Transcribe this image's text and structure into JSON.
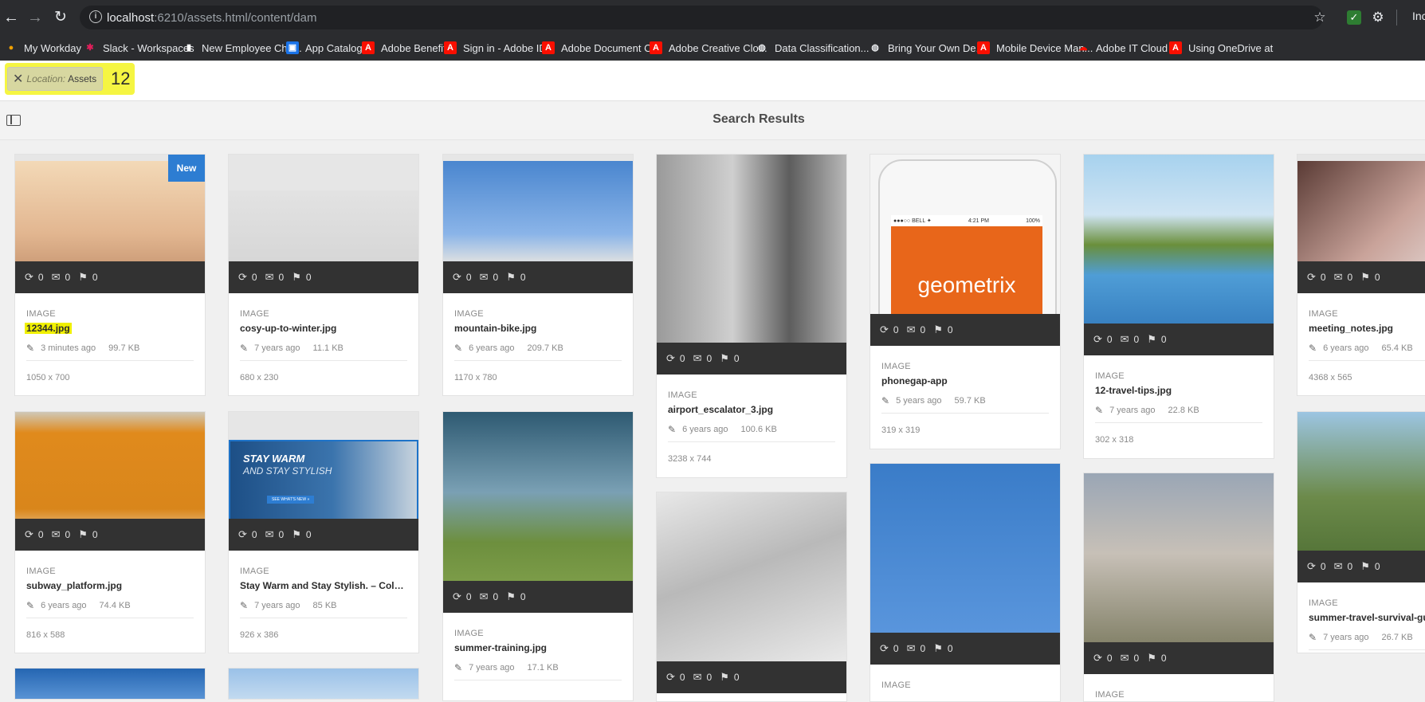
{
  "browser": {
    "url_host": "localhost",
    "url_rest": ":6210/assets.html/content/dam",
    "right_partial": "Inc",
    "bookmarks": [
      {
        "label": "My Workday",
        "icon": "workday-icon",
        "color": "#f0a000"
      },
      {
        "label": "Slack - Workspaces",
        "icon": "slack-icon",
        "color": "#e01e5a"
      },
      {
        "label": "New Employee Che...",
        "icon": "page-icon",
        "color": "#ffffff"
      },
      {
        "label": "App Catalog",
        "icon": "app-catalog-icon",
        "color": "#1a73e8"
      },
      {
        "label": "Adobe Benefits",
        "icon": "adobe-icon",
        "color": "#fa0f00"
      },
      {
        "label": "Sign in - Adobe ID",
        "icon": "adobe-icon",
        "color": "#fa0f00"
      },
      {
        "label": "Adobe Document C...",
        "icon": "acrobat-icon",
        "color": "#fa0f00"
      },
      {
        "label": "Adobe Creative Clo...",
        "icon": "adobe-icon",
        "color": "#fa0f00"
      },
      {
        "label": "Data Classification...",
        "icon": "globe-icon",
        "color": "#e8eaed"
      },
      {
        "label": "Bring Your Own De...",
        "icon": "globe-icon",
        "color": "#e8eaed"
      },
      {
        "label": "Mobile Device Man...",
        "icon": "adobe-icon",
        "color": "#fa0f00"
      },
      {
        "label": "Adobe IT Cloud",
        "icon": "cloud-icon",
        "color": "#fa0f00"
      },
      {
        "label": "Using OneDrive at",
        "icon": "adobe-icon",
        "color": "#fa0f00"
      }
    ]
  },
  "omnibar": {
    "tag_label": "Location:",
    "tag_value": "Assets",
    "count": "12"
  },
  "actionbar": {
    "title": "Search Results"
  },
  "cards": [
    {
      "type": "IMAGE",
      "name": "12344.jpg",
      "age": "3 minutes ago",
      "size": "99.7 KB",
      "dims": "1050 x 700",
      "refs": "0",
      "comments": "0",
      "tasks": "0",
      "badge": "New"
    },
    {
      "type": "IMAGE",
      "name": "cosy-up-to-winter.jpg",
      "age": "7 years ago",
      "size": "11.1 KB",
      "dims": "680 x 230",
      "refs": "0",
      "comments": "0",
      "tasks": "0"
    },
    {
      "type": "IMAGE",
      "name": "mountain-bike.jpg",
      "age": "6 years ago",
      "size": "209.7 KB",
      "dims": "1170 x 780",
      "refs": "0",
      "comments": "0",
      "tasks": "0"
    },
    {
      "type": "IMAGE",
      "name": "airport_escalator_3.jpg",
      "age": "6 years ago",
      "size": "100.6 KB",
      "dims": "3238 x 744",
      "refs": "0",
      "comments": "0",
      "tasks": "0"
    },
    {
      "type": "IMAGE",
      "name": "phonegap-app",
      "age": "5 years ago",
      "size": "59.7 KB",
      "dims": "319 x 319",
      "refs": "0",
      "comments": "0",
      "tasks": "0",
      "phone_text": "geometrix",
      "phone_status_left": "●●●○○ BELL ✦",
      "phone_status_time": "4:21 PM",
      "phone_status_right": "100%"
    },
    {
      "type": "IMAGE",
      "name": "12-travel-tips.jpg",
      "age": "7 years ago",
      "size": "22.8 KB",
      "dims": "302 x 318",
      "refs": "0",
      "comments": "0",
      "tasks": "0"
    },
    {
      "type": "IMAGE",
      "name": "meeting_notes.jpg",
      "age": "6 years ago",
      "size": "65.4 KB",
      "dims": "4368 x 565",
      "refs": "0",
      "comments": "0",
      "tasks": "0"
    },
    {
      "type": "IMAGE",
      "name": "subway_platform.jpg",
      "age": "6 years ago",
      "size": "74.4 KB",
      "dims": "816 x 588",
      "refs": "0",
      "comments": "0",
      "tasks": "0"
    },
    {
      "type": "IMAGE",
      "name": "Stay Warm and Stay Stylish. – Cold ...",
      "age": "7 years ago",
      "size": "85 KB",
      "dims": "926 x 386",
      "refs": "0",
      "comments": "0",
      "tasks": "0",
      "banner_title": "STAY WARM",
      "banner_sub": "AND STAY STYLISH",
      "banner_btn": "SEE WHAT'S NEW »"
    },
    {
      "type": "IMAGE",
      "name": "summer-training.jpg",
      "age": "7 years ago",
      "size": "17.1 KB",
      "refs": "0",
      "comments": "0",
      "tasks": "0"
    },
    {
      "refs": "0",
      "comments": "0",
      "tasks": "0"
    },
    {
      "type": "IMAGE",
      "refs": "0",
      "comments": "0",
      "tasks": "0"
    },
    {
      "type": "IMAGE",
      "refs": "0",
      "comments": "0",
      "tasks": "0"
    },
    {
      "type": "IMAGE",
      "name": "summer-travel-survival-gu",
      "age": "7 years ago",
      "size": "26.7 KB",
      "refs": "0",
      "comments": "0",
      "tasks": "0"
    }
  ],
  "colors": {
    "chrome_bg": "#2b2c2f",
    "highlight": "#f5f542",
    "new_badge": "#2d7dd2",
    "stats_bar": "#323232"
  }
}
